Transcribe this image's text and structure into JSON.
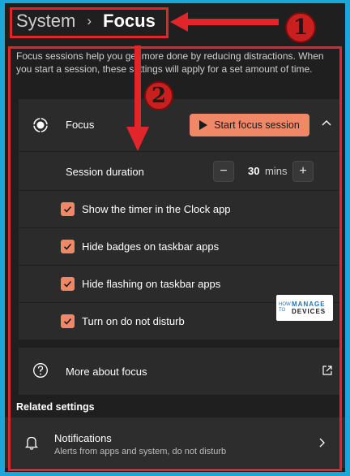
{
  "breadcrumb": {
    "parent": "System",
    "separator": "›",
    "current": "Focus"
  },
  "description": "Focus sessions help you get more done by reducing distractions. When you start a session, these settings will apply for a set amount of time.",
  "focus_card": {
    "title": "Focus",
    "start_button": "Start focus session",
    "session_duration_label": "Session duration",
    "duration_value": "30",
    "duration_unit": "mins",
    "minus": "−",
    "plus": "+",
    "options": [
      {
        "label": "Show the timer in the Clock app",
        "checked": true
      },
      {
        "label": "Hide badges on taskbar apps",
        "checked": true
      },
      {
        "label": "Hide flashing on taskbar apps",
        "checked": true
      },
      {
        "label": "Turn on do not disturb",
        "checked": true
      }
    ]
  },
  "more_about": {
    "label": "More about focus"
  },
  "related_settings": {
    "heading": "Related settings",
    "notifications": {
      "title": "Notifications",
      "subtitle": "Alerts from apps and system, do not disturb"
    }
  },
  "annotations": {
    "marker_1": "1",
    "marker_2": "2"
  },
  "watermark": {
    "line1": "HOW TO",
    "line2": "MANAGE",
    "line3": "DEVICES"
  },
  "colors": {
    "accent": "#f08868",
    "annotation_red": "#e0262a",
    "border_blue": "#1aa6d9"
  }
}
